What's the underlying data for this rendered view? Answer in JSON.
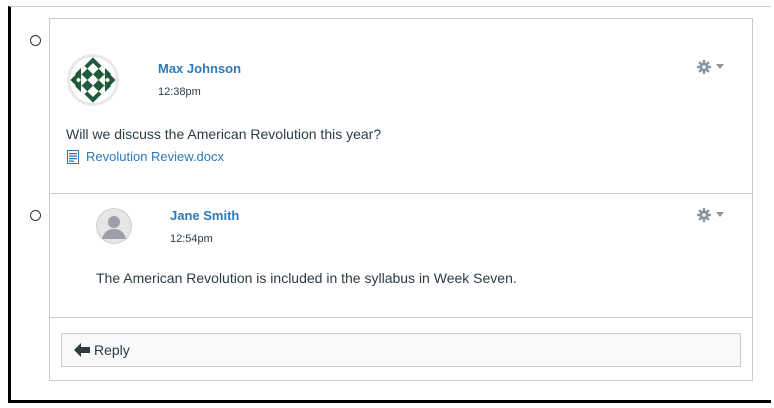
{
  "entries": [
    {
      "author": "Max Johnson",
      "time": "12:38pm",
      "message": "Will we discuss the American Revolution this year?",
      "attachment": "Revolution Review.docx",
      "avatar_icon": "patterned-avatar-icon"
    },
    {
      "author": "Jane Smith",
      "time": "12:54pm",
      "message": "The American Revolution is included in the syllabus in Week Seven.",
      "avatar_icon": "default-user-avatar-icon"
    }
  ],
  "reply": {
    "label": "Reply",
    "icon": "reply-arrow-icon"
  },
  "colors": {
    "link": "#2d7ab9",
    "text": "#2d3b45",
    "border": "#c7cdd1",
    "gear": "#8b969e"
  }
}
